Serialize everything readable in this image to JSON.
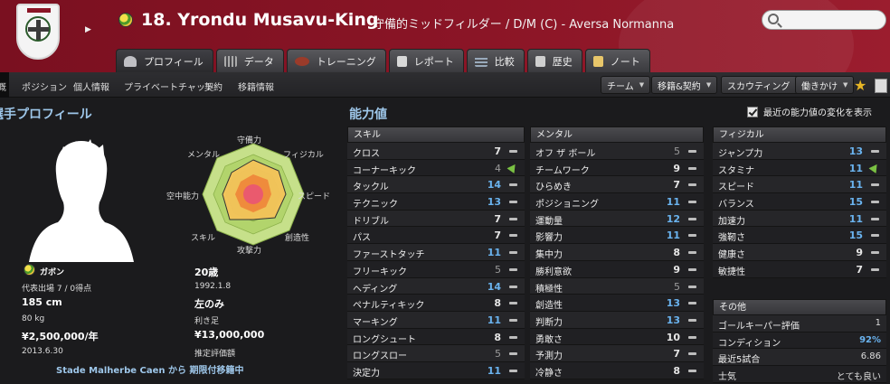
{
  "header": {
    "player_name": "18. Yrondu Musavu-King",
    "role": "守備的ミッドフィルダー / D/M (C) - Aversa Normanna",
    "search_placeholder": ""
  },
  "tabs": [
    {
      "label": "プロフィール",
      "icon": "profile-icon"
    },
    {
      "label": "データ",
      "icon": "data-icon"
    },
    {
      "label": "トレーニング",
      "icon": "training-icon"
    },
    {
      "label": "レポート",
      "icon": "report-icon"
    },
    {
      "label": "比較",
      "icon": "compare-icon"
    },
    {
      "label": "歴史",
      "icon": "history-icon"
    },
    {
      "label": "ノート",
      "icon": "notes-icon"
    }
  ],
  "subnav": {
    "first": "概",
    "items": [
      "ポジション",
      "個人情報",
      "プライベートチャット",
      "契約",
      "移籍情報"
    ],
    "buttons": [
      "チーム",
      "移籍&契約",
      "スカウティング",
      "働きかけ"
    ]
  },
  "profile": {
    "title": "選手プロフィール",
    "radar_labels": {
      "defence": "守備力",
      "physical": "フィジカル",
      "speed": "スピード",
      "creativity": "創造性",
      "attack": "攻撃力",
      "technique": "スキル",
      "aerial": "空中能力",
      "mental": "メンタル"
    },
    "nationality": "ガボン",
    "age": "20歳",
    "caps": "代表出場 7 / 0得点",
    "dob": "1992.1.8",
    "height": "185 cm",
    "foot": "左のみ",
    "weight": "80 kg",
    "foot_label": "利き足",
    "wage": "¥2,500,000/年",
    "value": "¥13,000,000",
    "contract_end": "2013.6.30",
    "value_label": "推定評価額",
    "loan_text": "Stade Malherbe Caen から 期限付移籍中"
  },
  "attributes": {
    "title": "能力値",
    "show_recent_label": "最近の能力値の変化を表示",
    "skill": {
      "header": "スキル",
      "rows": [
        {
          "name": "クロス",
          "value": "7",
          "trend": "flat"
        },
        {
          "name": "コーナーキック",
          "value": "4",
          "trend": "up"
        },
        {
          "name": "タックル",
          "value": "14",
          "trend": "flat"
        },
        {
          "name": "テクニック",
          "value": "13",
          "trend": "flat"
        },
        {
          "name": "ドリブル",
          "value": "7",
          "trend": "flat"
        },
        {
          "name": "パス",
          "value": "7",
          "trend": "flat"
        },
        {
          "name": "ファーストタッチ",
          "value": "11",
          "trend": "flat"
        },
        {
          "name": "フリーキック",
          "value": "5",
          "trend": "flat"
        },
        {
          "name": "ヘディング",
          "value": "14",
          "trend": "flat"
        },
        {
          "name": "ペナルティキック",
          "value": "8",
          "trend": "flat"
        },
        {
          "name": "マーキング",
          "value": "11",
          "trend": "flat"
        },
        {
          "name": "ロングシュート",
          "value": "8",
          "trend": "flat"
        },
        {
          "name": "ロングスロー",
          "value": "5",
          "trend": "flat"
        },
        {
          "name": "決定力",
          "value": "11",
          "trend": "flat"
        }
      ]
    },
    "mental": {
      "header": "メンタル",
      "rows": [
        {
          "name": "オフ ザ ボール",
          "value": "5",
          "trend": "flat"
        },
        {
          "name": "チームワーク",
          "value": "9",
          "trend": "flat"
        },
        {
          "name": "ひらめき",
          "value": "7",
          "trend": "flat"
        },
        {
          "name": "ポジショニング",
          "value": "11",
          "trend": "flat"
        },
        {
          "name": "運動量",
          "value": "12",
          "trend": "flat"
        },
        {
          "name": "影響力",
          "value": "11",
          "trend": "flat"
        },
        {
          "name": "集中力",
          "value": "8",
          "trend": "flat"
        },
        {
          "name": "勝利意欲",
          "value": "9",
          "trend": "flat"
        },
        {
          "name": "積極性",
          "value": "5",
          "trend": "flat"
        },
        {
          "name": "創造性",
          "value": "13",
          "trend": "flat"
        },
        {
          "name": "判断力",
          "value": "13",
          "trend": "flat"
        },
        {
          "name": "勇敢さ",
          "value": "10",
          "trend": "flat"
        },
        {
          "name": "予測力",
          "value": "7",
          "trend": "flat"
        },
        {
          "name": "冷静さ",
          "value": "8",
          "trend": "flat"
        }
      ]
    },
    "physical": {
      "header": "フィジカル",
      "rows": [
        {
          "name": "ジャンプ力",
          "value": "13",
          "trend": "flat"
        },
        {
          "name": "スタミナ",
          "value": "11",
          "trend": "up"
        },
        {
          "name": "スピード",
          "value": "11",
          "trend": "flat"
        },
        {
          "name": "バランス",
          "value": "15",
          "trend": "flat"
        },
        {
          "name": "加速力",
          "value": "11",
          "trend": "flat"
        },
        {
          "name": "強靭さ",
          "value": "15",
          "trend": "flat"
        },
        {
          "name": "健康さ",
          "value": "9",
          "trend": "flat"
        },
        {
          "name": "敏捷性",
          "value": "7",
          "trend": "flat"
        }
      ]
    },
    "other": {
      "header": "その他",
      "rows": [
        {
          "name": "ゴールキーパー評価",
          "value": "1"
        },
        {
          "name": "コンディション",
          "value": "92%"
        },
        {
          "name": "最近5試合",
          "value": "6.86"
        },
        {
          "name": "士気",
          "value": "とても良い"
        }
      ]
    }
  },
  "colors": {
    "header_red": "#8b1526",
    "accent_blue": "#6ab3ef",
    "trend_up_green": "#7ac143",
    "star_gold": "#e7b625"
  }
}
